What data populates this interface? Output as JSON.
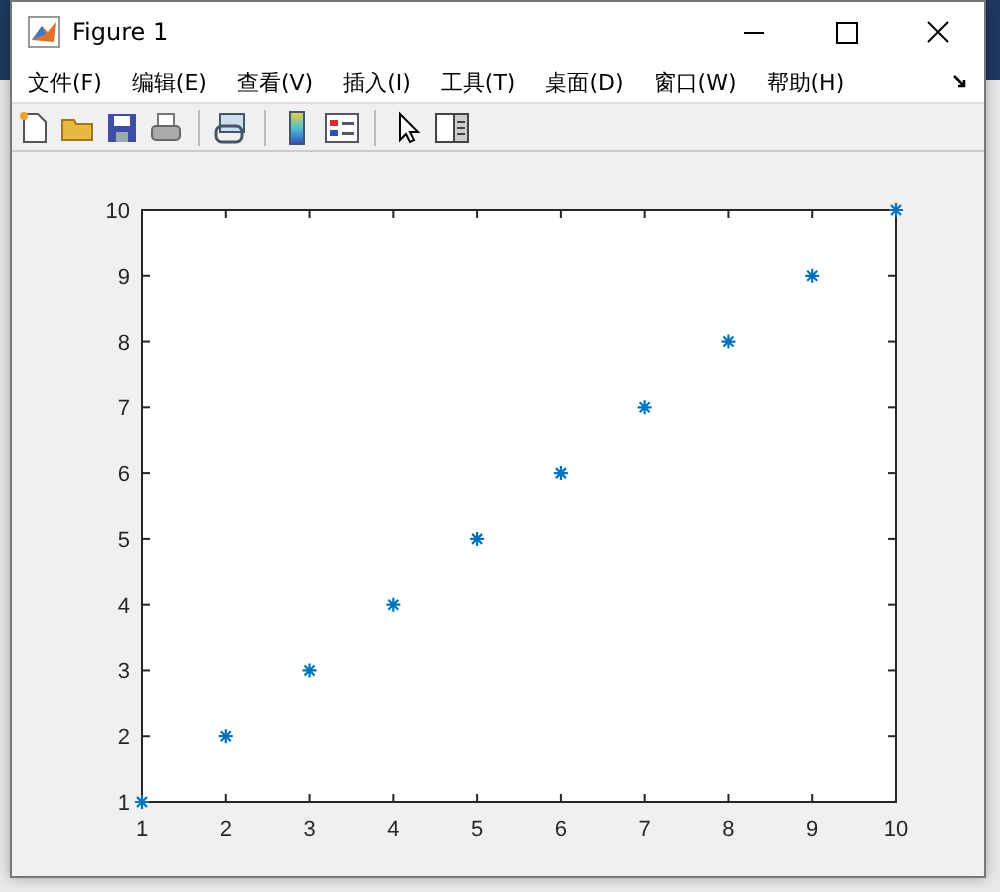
{
  "window": {
    "title": "Figure 1"
  },
  "menu": [
    "文件(F)",
    "编辑(E)",
    "查看(V)",
    "插入(I)",
    "工具(T)",
    "桌面(D)",
    "窗口(W)",
    "帮助(H)"
  ],
  "toolbar": [
    {
      "kind": "new"
    },
    {
      "kind": "open"
    },
    {
      "kind": "save"
    },
    {
      "kind": "print"
    },
    {
      "kind": "sep"
    },
    {
      "kind": "link"
    },
    {
      "kind": "sep"
    },
    {
      "kind": "colorbar"
    },
    {
      "kind": "legend"
    },
    {
      "kind": "sep"
    },
    {
      "kind": "pointer"
    },
    {
      "kind": "panel"
    }
  ],
  "chart_data": {
    "type": "scatter",
    "x": [
      1,
      2,
      3,
      4,
      5,
      6,
      7,
      8,
      9,
      10
    ],
    "series": [
      {
        "color": "#0072bd",
        "values": [
          1,
          2,
          3,
          4,
          5,
          6,
          7,
          8,
          9,
          10
        ]
      }
    ],
    "xlim": [
      1,
      10
    ],
    "ylim": [
      1,
      10
    ],
    "xticks": [
      1,
      2,
      3,
      4,
      5,
      6,
      7,
      8,
      9,
      10
    ],
    "yticks": [
      1,
      2,
      3,
      4,
      5,
      6,
      7,
      8,
      9,
      10
    ]
  }
}
